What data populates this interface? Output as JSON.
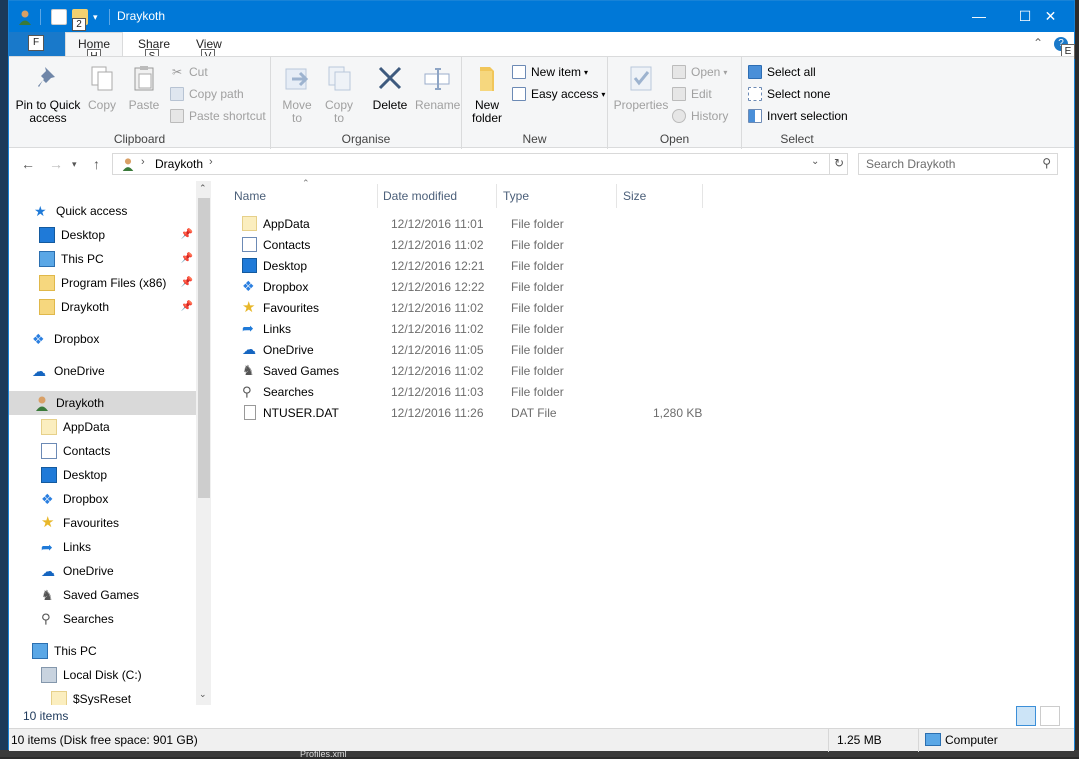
{
  "window": {
    "title": "Draykoth",
    "qat_badge": "2",
    "accent": "#0078d7",
    "minimize": "—",
    "maximize": "☐",
    "close": "✕"
  },
  "ribbon_tabs": {
    "file_keytip": "F",
    "home": "Home",
    "home_keytip": "H",
    "share": "Share",
    "share_keytip": "S",
    "view": "View",
    "view_keytip": "V",
    "help_keytip": "E"
  },
  "ribbon": {
    "clipboard": {
      "label": "Clipboard",
      "pin": "Pin to Quick access",
      "copy": "Copy",
      "paste": "Paste",
      "cut": "Cut",
      "copy_path": "Copy path",
      "paste_shortcut": "Paste shortcut"
    },
    "organise": {
      "label": "Organise",
      "move_to": "Move to",
      "copy_to": "Copy to",
      "delete": "Delete",
      "rename": "Rename"
    },
    "new": {
      "label": "New",
      "new_folder": "New folder",
      "new_item": "New item",
      "easy_access": "Easy access"
    },
    "open": {
      "label": "Open",
      "properties": "Properties",
      "open": "Open",
      "edit": "Edit",
      "history": "History"
    },
    "select": {
      "label": "Select",
      "select_all": "Select all",
      "select_none": "Select none",
      "invert_selection": "Invert selection"
    }
  },
  "address": {
    "path": "Draykoth",
    "search_placeholder": "Search Draykoth"
  },
  "nav": {
    "quick_access": "Quick access",
    "quick_items": [
      {
        "label": "Desktop"
      },
      {
        "label": "This PC"
      },
      {
        "label": "Program Files (x86)"
      },
      {
        "label": "Draykoth"
      }
    ],
    "dropbox": "Dropbox",
    "onedrive": "OneDrive",
    "user": "Draykoth",
    "user_items": [
      {
        "label": "AppData"
      },
      {
        "label": "Contacts"
      },
      {
        "label": "Desktop"
      },
      {
        "label": "Dropbox"
      },
      {
        "label": "Favourites"
      },
      {
        "label": "Links"
      },
      {
        "label": "OneDrive"
      },
      {
        "label": "Saved Games"
      },
      {
        "label": "Searches"
      }
    ],
    "this_pc": "This PC",
    "local_disk": "Local Disk (C:)",
    "sysreset": "$SysReset"
  },
  "columns": {
    "name": "Name",
    "date": "Date modified",
    "type": "Type",
    "size": "Size"
  },
  "files": [
    {
      "name": "AppData",
      "date": "12/12/2016 11:01",
      "type": "File folder",
      "size": ""
    },
    {
      "name": "Contacts",
      "date": "12/12/2016 11:02",
      "type": "File folder",
      "size": ""
    },
    {
      "name": "Desktop",
      "date": "12/12/2016 12:21",
      "type": "File folder",
      "size": ""
    },
    {
      "name": "Dropbox",
      "date": "12/12/2016 12:22",
      "type": "File folder",
      "size": ""
    },
    {
      "name": "Favourites",
      "date": "12/12/2016 11:02",
      "type": "File folder",
      "size": ""
    },
    {
      "name": "Links",
      "date": "12/12/2016 11:02",
      "type": "File folder",
      "size": ""
    },
    {
      "name": "OneDrive",
      "date": "12/12/2016 11:05",
      "type": "File folder",
      "size": ""
    },
    {
      "name": "Saved Games",
      "date": "12/12/2016 11:02",
      "type": "File folder",
      "size": ""
    },
    {
      "name": "Searches",
      "date": "12/12/2016 11:03",
      "type": "File folder",
      "size": ""
    },
    {
      "name": "NTUSER.DAT",
      "date": "12/12/2016 11:26",
      "type": "DAT File",
      "size": "1,280 KB"
    }
  ],
  "status": {
    "item_count": "10 items",
    "disk_free": "10 items (Disk free space: 901 GB)",
    "size": "1.25 MB",
    "location": "Computer"
  },
  "background": {
    "taskbar_text": "Profiles.xml"
  }
}
